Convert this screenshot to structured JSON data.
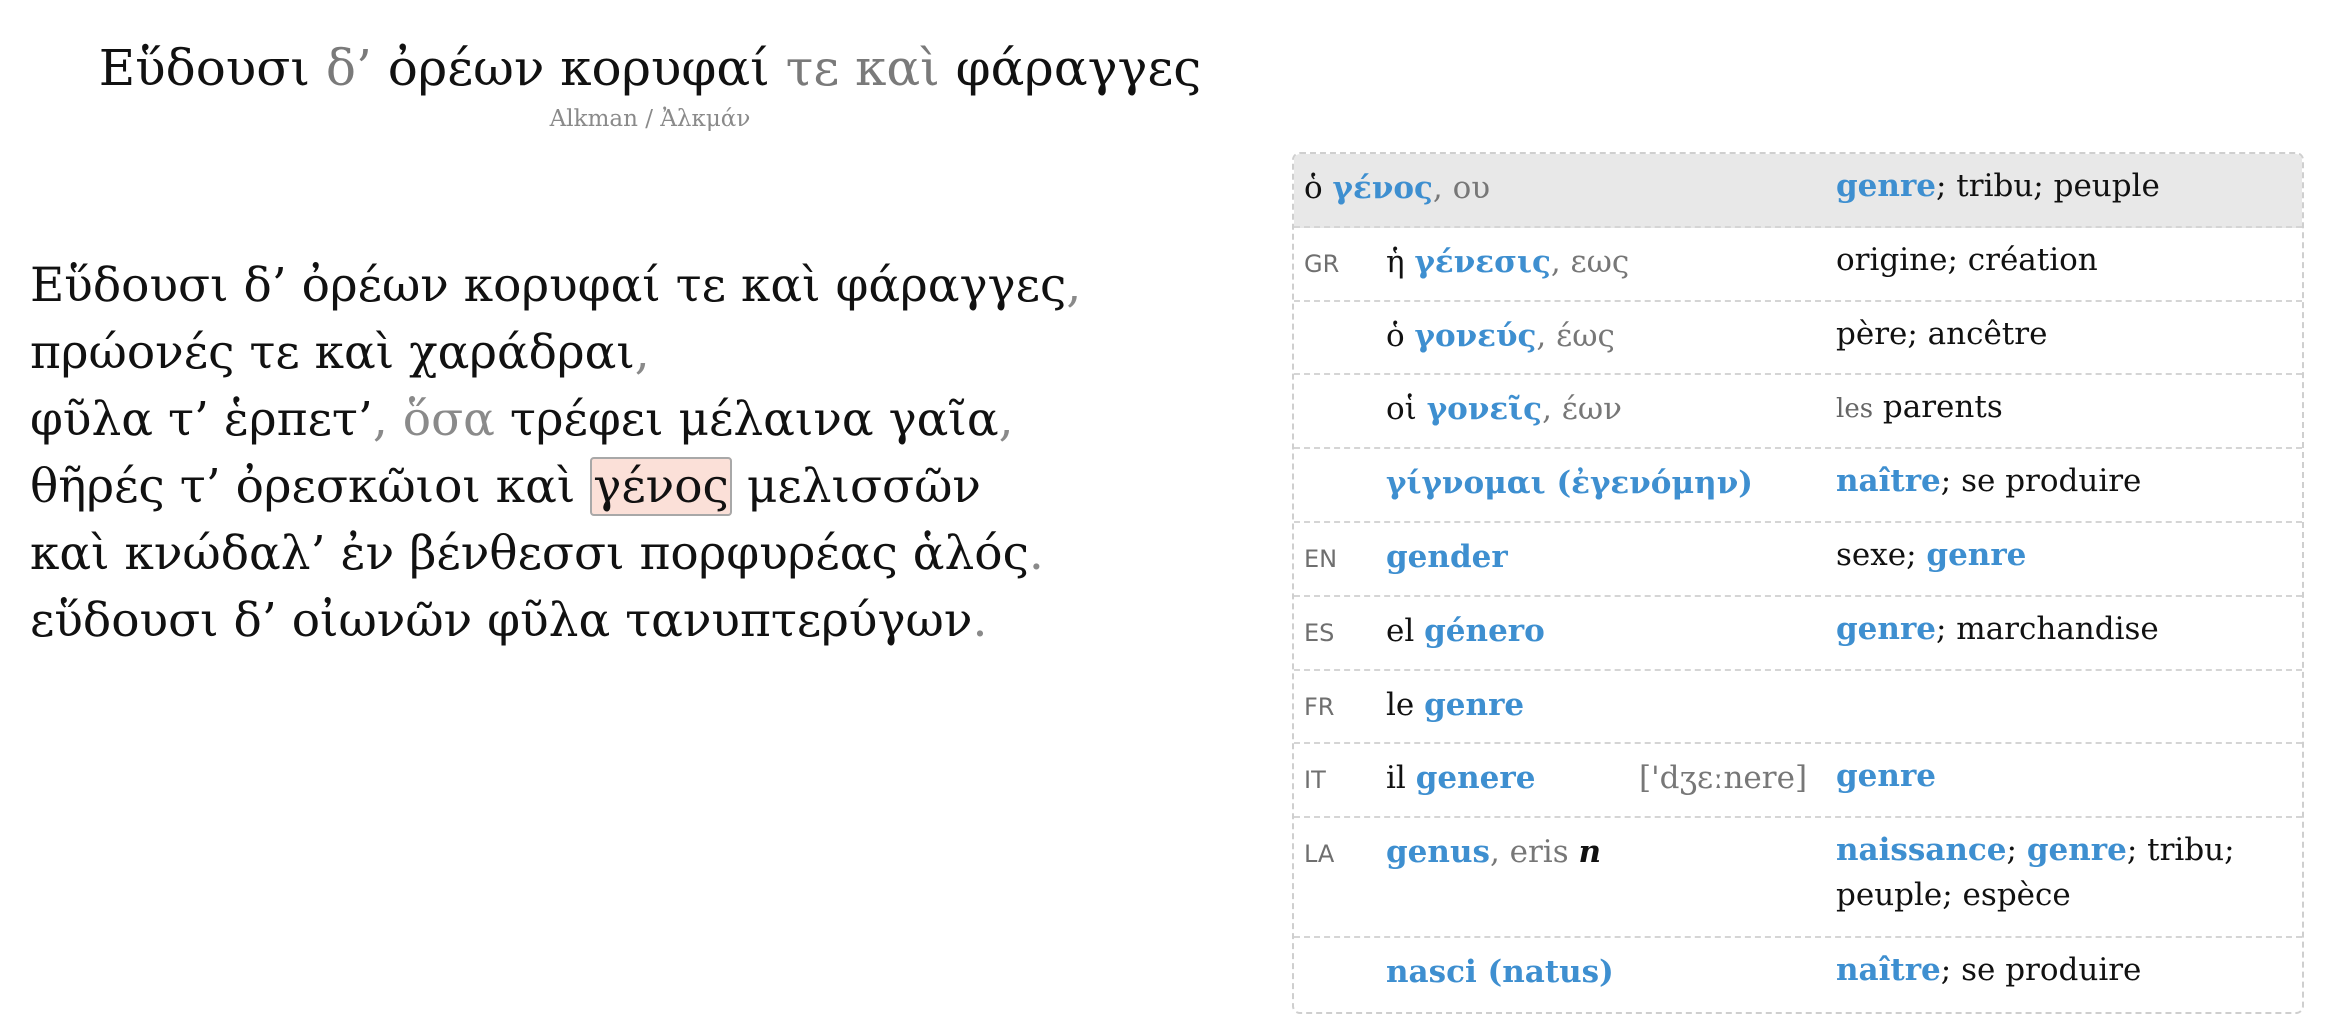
{
  "title": {
    "w1": "Εὕδουσι",
    "w2": "δ’",
    "w3": "ὀρέων κορυφαί",
    "w4": "τε καὶ",
    "w5": "φάραγγες"
  },
  "author": "Alkman / Ἀλκμάν",
  "poem": {
    "line1": {
      "text": "Εὕδουσι δ’ ὀρέων κορυφαί τε καὶ φάραγγες",
      "punct": ","
    },
    "line2": {
      "text": "πρώονές τε καὶ χαράδραι",
      "punct": ","
    },
    "line3": {
      "text1": "φῦλα τ’ ἑρπετ’",
      "punct1": ",",
      "muted": "ὅσα",
      "text2": "τρέφει μέλαινα γαῖα",
      "punct2": ","
    },
    "line4": {
      "text1": "θῆρές τ’ ὀρεσκῶιοι καὶ",
      "highlight": "γένος",
      "text2": "μελισσῶν"
    },
    "line5": {
      "text": "καὶ κνώδαλ’ ἐν βένθεσσι πορφυρέας ἁλός",
      "punct": "."
    },
    "line6": {
      "text": "εὕδουσι δ’ οἰωνῶν φῦλα τανυπτερύγων",
      "punct": "."
    }
  },
  "dictionary": {
    "head": {
      "article": "ὁ",
      "lemma": "γένος",
      "suffix": ", ου",
      "m1": "genre",
      "m2": "; tribu; peuple"
    },
    "rows": [
      {
        "lang": "GR",
        "article": "ἡ",
        "lemma": "γένεσις",
        "suffix": ", εως",
        "m_text": "origine; création"
      },
      {
        "article": "ὁ",
        "lemma": "γονεύς",
        "suffix": ", έως",
        "m_text": "père; ancêtre"
      },
      {
        "article": "οἱ",
        "lemma": "γονεῖς",
        "suffix": ", έων",
        "m_small": "les",
        "m_text": "parents"
      },
      {
        "lemma": "γίγνομαι (ἐγενόμην)",
        "m_link": "naître",
        "m_text": "; se produire"
      },
      {
        "lang": "EN",
        "lemma": "gender",
        "m_text": "sexe;",
        "m_link2": "genre"
      },
      {
        "lang": "ES",
        "article": "el",
        "lemma": "género",
        "m_link": "genre",
        "m_text": "; marchandise"
      },
      {
        "lang": "FR",
        "article": "le",
        "lemma": "genre"
      },
      {
        "lang": "IT",
        "article": "il",
        "lemma": "genere",
        "pron": "['dʒɛːnere]",
        "m_link": "genre"
      },
      {
        "lang": "LA",
        "lemma": "genus",
        "suffix": ", eris",
        "gender": "n",
        "m_link": "naissance",
        "m_sep": ";",
        "m_link2": "genre",
        "m_text": "; tribu; peuple; espèce"
      },
      {
        "lemma": "nasci (natus)",
        "m_link": "naître",
        "m_text": "; se produire"
      }
    ]
  },
  "colors": {
    "link": "#3e8fd0",
    "highlight_bg": "#fbe0d8",
    "muted": "#8a8a8a",
    "header_bg": "#e8e8e8"
  }
}
